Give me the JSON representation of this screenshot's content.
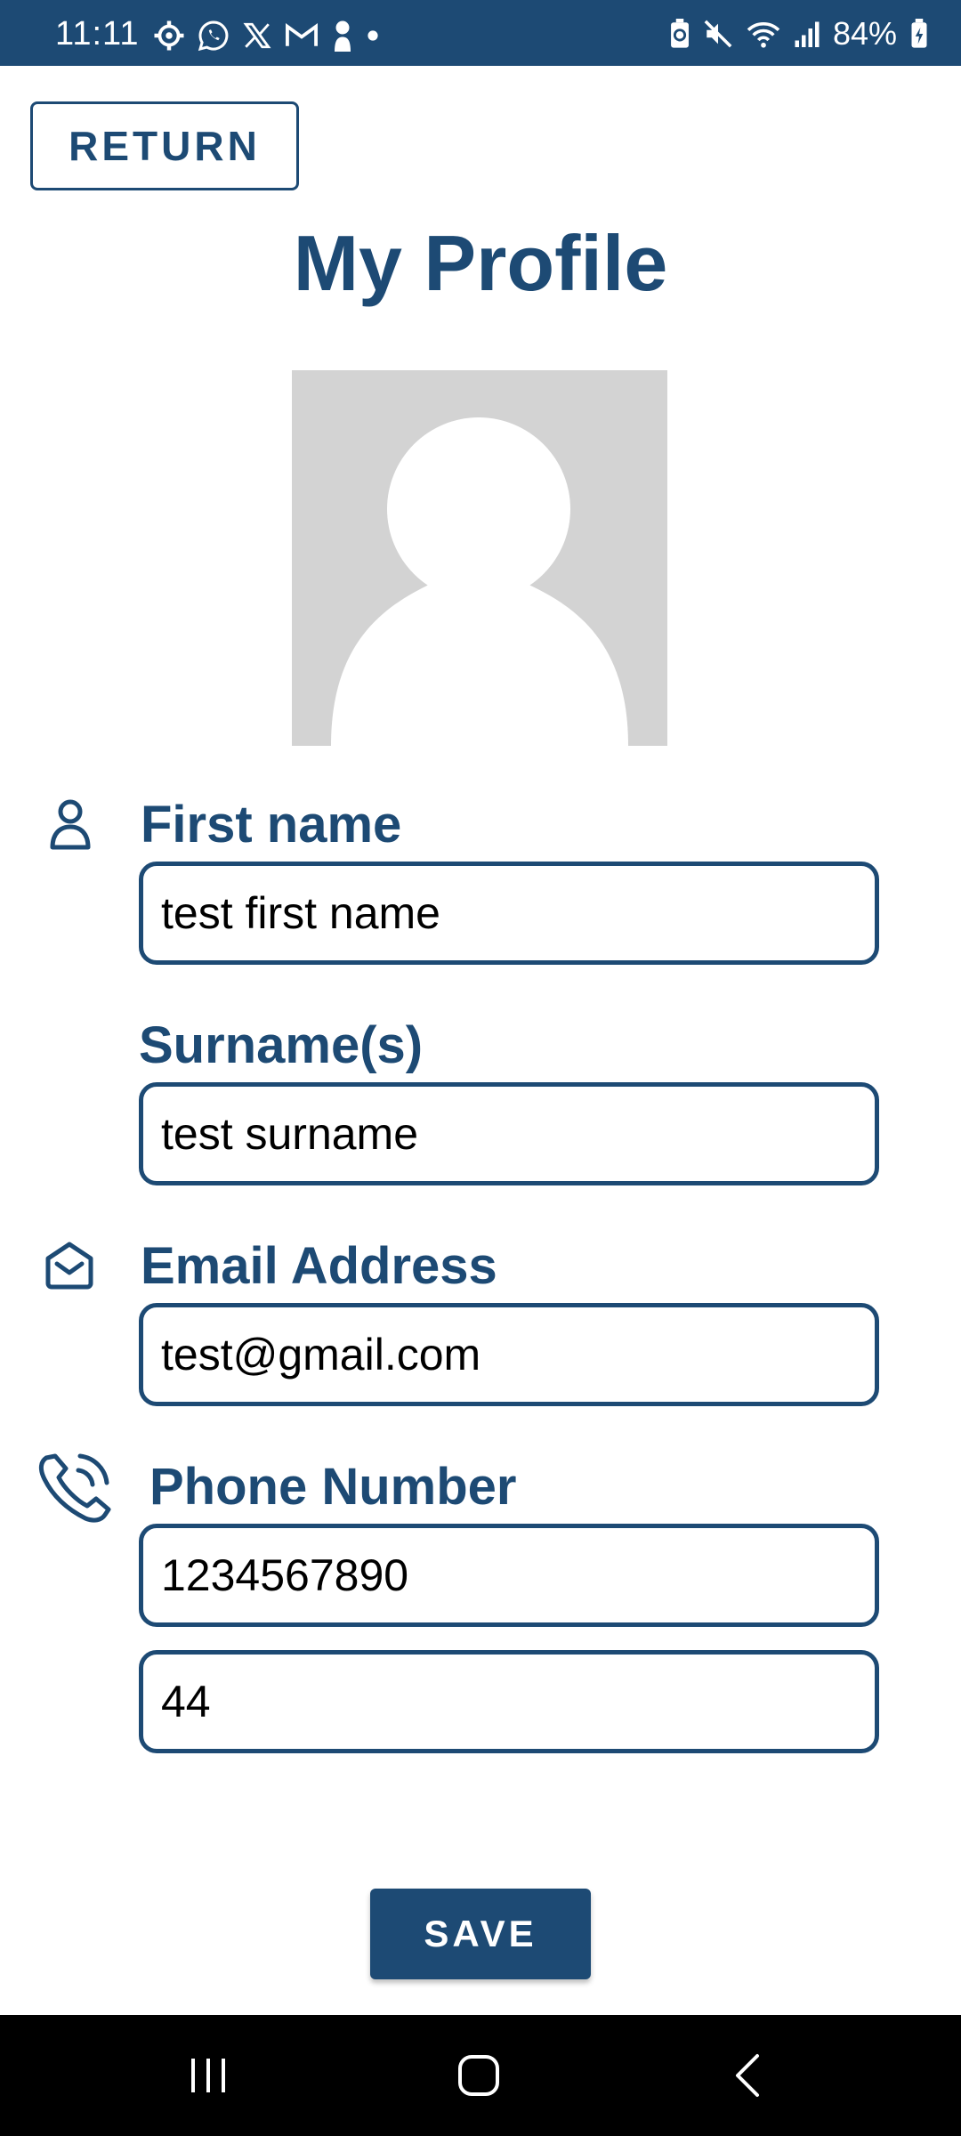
{
  "status_bar": {
    "time": "11:11",
    "battery": "84%",
    "left_icons": [
      "settings-icon",
      "whatsapp-icon",
      "x-icon",
      "gmail-icon",
      "person-icon",
      "dot-icon"
    ],
    "right_icons": [
      "battery-saver-icon",
      "mute-icon",
      "wifi-icon",
      "signal-icon",
      "battery-icon"
    ]
  },
  "header": {
    "return_label": "RETURN",
    "title": "My Profile"
  },
  "form": {
    "first_name": {
      "label": "First name",
      "value": "test first name",
      "icon": "person-icon"
    },
    "surname": {
      "label": "Surname(s)",
      "value": "test surname"
    },
    "email": {
      "label": "Email Address",
      "value": "test@gmail.com",
      "icon": "mail-icon"
    },
    "phone": {
      "label": "Phone Number",
      "value": "1234567890",
      "country_code": "44",
      "icon": "phone-icon"
    }
  },
  "actions": {
    "save_label": "SAVE"
  },
  "colors": {
    "primary": "#1d4a74",
    "placeholder_avatar": "#d3d3d3",
    "nav_bar": "#000000"
  },
  "nav_bar": {
    "buttons": [
      "recent-apps-icon",
      "home-icon",
      "back-icon"
    ]
  }
}
